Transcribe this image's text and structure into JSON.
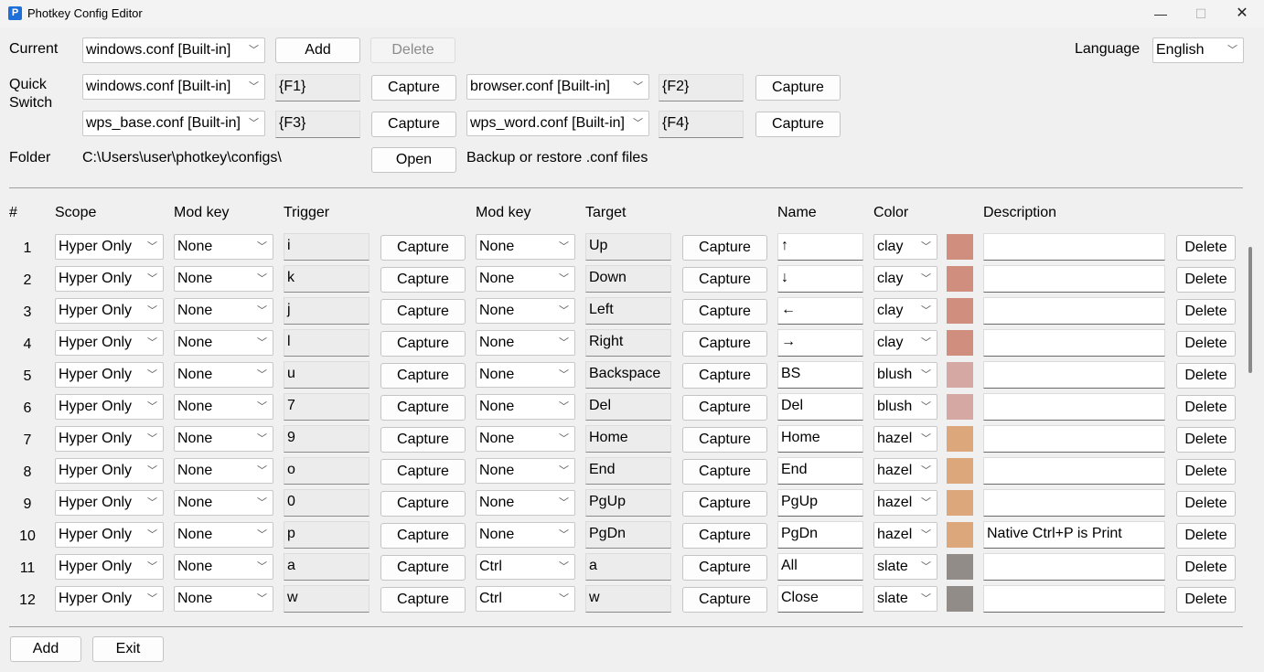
{
  "window": {
    "title": "Photkey Config Editor",
    "icon": "P",
    "minimize_icon": "—",
    "maximize_icon": "☐",
    "close_icon": "✕"
  },
  "top": {
    "current_label": "Current",
    "current_value": "windows.conf [Built-in]",
    "add_label": "Add",
    "delete_label": "Delete",
    "language_label": "Language",
    "language_value": "English",
    "quick_label_line1": "Quick",
    "quick_label_line2": "Switch",
    "quick": [
      {
        "conf": "windows.conf [Built-in]",
        "key": "{F1}",
        "capture": "Capture"
      },
      {
        "conf": "browser.conf [Built-in]",
        "key": "{F2}",
        "capture": "Capture"
      },
      {
        "conf": "wps_base.conf [Built-in]",
        "key": "{F3}",
        "capture": "Capture"
      },
      {
        "conf": "wps_word.conf [Built-in]",
        "key": "{F4}",
        "capture": "Capture"
      }
    ],
    "folder_label": "Folder",
    "folder_path": "C:\\Users\\user\\photkey\\configs\\",
    "open_label": "Open",
    "backup_text": "Backup or restore .conf files"
  },
  "table": {
    "headers": {
      "num": "#",
      "scope": "Scope",
      "mod1": "Mod key",
      "trigger": "Trigger",
      "mod2": "Mod key",
      "target": "Target",
      "name": "Name",
      "color": "Color",
      "description": "Description"
    },
    "capture_label": "Capture",
    "delete_label": "Delete",
    "rows": [
      {
        "num": "1",
        "scope": "Hyper Only",
        "mod1": "None",
        "trigger": "i",
        "mod2": "None",
        "target": "Up",
        "name": "↑",
        "color": "clay",
        "hex": "#d08e7e",
        "desc": ""
      },
      {
        "num": "2",
        "scope": "Hyper Only",
        "mod1": "None",
        "trigger": "k",
        "mod2": "None",
        "target": "Down",
        "name": "↓",
        "color": "clay",
        "hex": "#d08e7e",
        "desc": ""
      },
      {
        "num": "3",
        "scope": "Hyper Only",
        "mod1": "None",
        "trigger": "j",
        "mod2": "None",
        "target": "Left",
        "name": "←",
        "color": "clay",
        "hex": "#d08e7e",
        "desc": ""
      },
      {
        "num": "4",
        "scope": "Hyper Only",
        "mod1": "None",
        "trigger": "l",
        "mod2": "None",
        "target": "Right",
        "name": "→",
        "color": "clay",
        "hex": "#d08e7e",
        "desc": ""
      },
      {
        "num": "5",
        "scope": "Hyper Only",
        "mod1": "None",
        "trigger": "u",
        "mod2": "None",
        "target": "Backspace",
        "name": "BS",
        "color": "blush",
        "hex": "#d6a8a4",
        "desc": ""
      },
      {
        "num": "6",
        "scope": "Hyper Only",
        "mod1": "None",
        "trigger": "7",
        "mod2": "None",
        "target": "Del",
        "name": "Del",
        "color": "blush",
        "hex": "#d6a8a4",
        "desc": ""
      },
      {
        "num": "7",
        "scope": "Hyper Only",
        "mod1": "None",
        "trigger": "9",
        "mod2": "None",
        "target": "Home",
        "name": "Home",
        "color": "hazel",
        "hex": "#dba77b",
        "desc": ""
      },
      {
        "num": "8",
        "scope": "Hyper Only",
        "mod1": "None",
        "trigger": "o",
        "mod2": "None",
        "target": "End",
        "name": "End",
        "color": "hazel",
        "hex": "#dba77b",
        "desc": ""
      },
      {
        "num": "9",
        "scope": "Hyper Only",
        "mod1": "None",
        "trigger": "0",
        "mod2": "None",
        "target": "PgUp",
        "name": "PgUp",
        "color": "hazel",
        "hex": "#dba77b",
        "desc": ""
      },
      {
        "num": "10",
        "scope": "Hyper Only",
        "mod1": "None",
        "trigger": "p",
        "mod2": "None",
        "target": "PgDn",
        "name": "PgDn",
        "color": "hazel",
        "hex": "#dba77b",
        "desc": "Native Ctrl+P is Print"
      },
      {
        "num": "11",
        "scope": "Hyper Only",
        "mod1": "None",
        "trigger": "a",
        "mod2": "Ctrl",
        "target": "a",
        "name": "All",
        "color": "slate",
        "hex": "#918c87",
        "desc": ""
      },
      {
        "num": "12",
        "scope": "Hyper Only",
        "mod1": "None",
        "trigger": "w",
        "mod2": "Ctrl",
        "target": "w",
        "name": "Close",
        "color": "slate",
        "hex": "#918c87",
        "desc": ""
      }
    ]
  },
  "bottom": {
    "add_label": "Add",
    "exit_label": "Exit"
  }
}
